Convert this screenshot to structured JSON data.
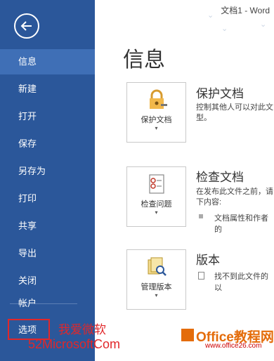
{
  "window": {
    "title": "文档1 - Word"
  },
  "sidebar": {
    "items": [
      {
        "label": "信息"
      },
      {
        "label": "新建"
      },
      {
        "label": "打开"
      },
      {
        "label": "保存"
      },
      {
        "label": "另存为"
      },
      {
        "label": "打印"
      },
      {
        "label": "共享"
      },
      {
        "label": "导出"
      },
      {
        "label": "关闭"
      }
    ],
    "bottom_items": [
      {
        "label": "帐户"
      },
      {
        "label": "选项"
      }
    ],
    "colors": {
      "background": "#2b579a",
      "active": "#3f6fb6"
    }
  },
  "main": {
    "title": "信息",
    "sections": [
      {
        "button_label": "保护文档",
        "icon": "lock-key-icon",
        "title": "保护文档",
        "desc_lines": [
          "控制其他人可以对此文",
          "型。"
        ]
      },
      {
        "button_label": "检查问题",
        "icon": "checklist-icon",
        "title": "检查文档",
        "desc_lines": [
          "在发布此文件之前，请",
          "下内容:"
        ],
        "bullets": [
          "文档属性和作者的"
        ]
      },
      {
        "button_label": "管理版本",
        "icon": "versions-search-icon",
        "title": "版本",
        "desc_lines": [
          "找不到此文件的以"
        ]
      }
    ]
  },
  "watermark": {
    "cn_text": "我爱微软",
    "url_text": "52MicrosoftCom",
    "site_name": "Office教程网",
    "site_url": "www.office26.com"
  }
}
